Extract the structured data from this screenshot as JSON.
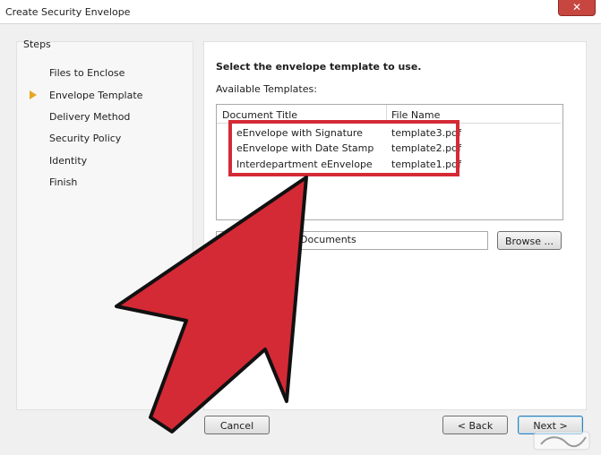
{
  "window": {
    "title": "Create Security Envelope",
    "close_glyph": "✕"
  },
  "steps": {
    "heading": "Steps",
    "items": [
      {
        "label": "Files to Enclose"
      },
      {
        "label": "Envelope Template"
      },
      {
        "label": "Delivery Method"
      },
      {
        "label": "Security Policy"
      },
      {
        "label": "Identity"
      },
      {
        "label": "Finish"
      }
    ],
    "current_index": 1
  },
  "main": {
    "instruction": "Select the envelope template to use.",
    "available_label": "Available Templates:",
    "columns": [
      "Document Title",
      "File Name"
    ],
    "rows": [
      {
        "title": "eEnvelope with Signature",
        "file": "template3.pdf"
      },
      {
        "title": "eEnvelope with Date Stamp",
        "file": "template2.pdf"
      },
      {
        "title": "Interdepartment eEnvelope",
        "file": "template1.pdf"
      }
    ],
    "path_value": "Documents",
    "browse_label": "Browse ..."
  },
  "footer": {
    "cancel_label": "Cancel",
    "back_label": "< Back",
    "next_label": "Next >"
  },
  "colors": {
    "highlight": "#d42a35",
    "arrow_fill": "#d42a35",
    "step_marker": "#e7a526"
  },
  "icons": [
    "close-icon",
    "current-step-arrow-icon",
    "annotation-arrow"
  ]
}
